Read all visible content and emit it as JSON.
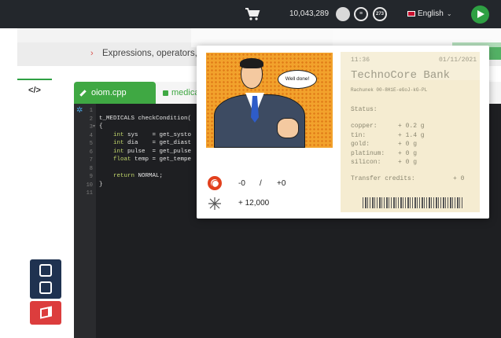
{
  "topbar": {
    "balance": "10,043,289",
    "badge_count": "273",
    "language": "English",
    "icons": [
      "cart-icon",
      "resource-icon",
      "bank-icon",
      "counter-icon",
      "play-icon"
    ]
  },
  "breadcrumb": {
    "text": "Expressions, operators, c"
  },
  "editor": {
    "toggle_label": "</>",
    "tabs": [
      {
        "label": "oiom.cpp"
      },
      {
        "label": "medica"
      }
    ],
    "line_numbers": [
      "1",
      "2",
      "3",
      "4",
      "5",
      "6",
      "7",
      "8",
      "9",
      "10",
      "11"
    ],
    "lines": [
      "",
      "t_MEDICALS checkCondition(",
      "{",
      "    int sys    = get_systo",
      "    int dia    = get_diast",
      "    int pulse  = get_pulse",
      "    float temp = get_tempe",
      "",
      "    return NORMAL;",
      "}",
      ""
    ]
  },
  "popup": {
    "speech": "Well done!",
    "lifebuoy_left": "-0",
    "lifebuoy_sep": "/",
    "lifebuoy_right": "+0",
    "reward": "+ 12,000"
  },
  "receipt": {
    "time": "11:36",
    "date": "01/11/2021",
    "bank": "TechnoCore Bank",
    "account": "Rachunek 00-8H1E-eGoJ-kG-PL",
    "status_label": "Status:",
    "items": [
      {
        "name": "copper:",
        "value": "+ 0.2 g"
      },
      {
        "name": "tin:",
        "value": "+ 1.4 g"
      },
      {
        "name": "gold:",
        "value": "+ 0 g"
      },
      {
        "name": "platinum:",
        "value": "+ 0 g"
      },
      {
        "name": "silicon:",
        "value": "+ 0 g"
      }
    ],
    "transfer_label": "Transfer credits:",
    "transfer_value": "+ 0"
  },
  "colors": {
    "accent_green": "#3fa843",
    "topbar_bg": "#23272c",
    "report_red": "#dc3d3d",
    "feedback_navy": "#1f3250",
    "receipt_paper": "#f5ecd1"
  }
}
